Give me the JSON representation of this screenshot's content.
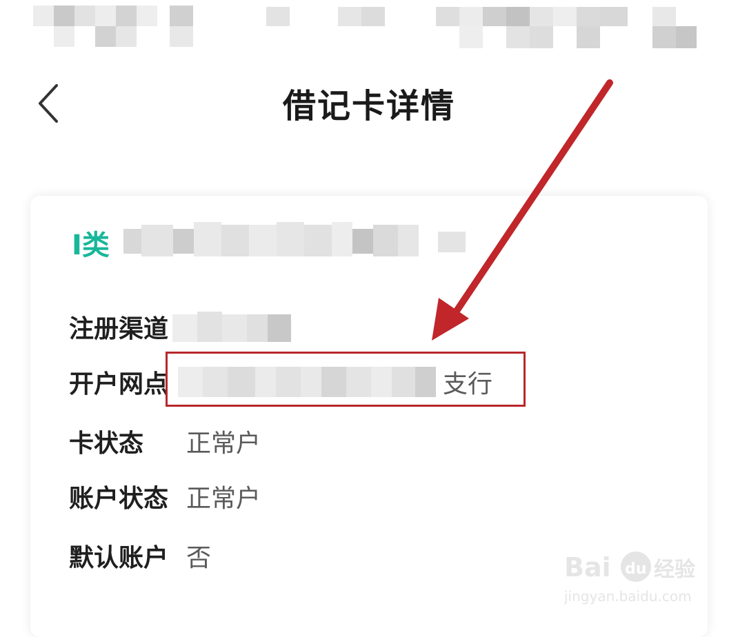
{
  "header": {
    "title": "借记卡详情",
    "back_icon": "chevron-left-icon"
  },
  "card": {
    "type_label": "I类",
    "rows": [
      {
        "label": "注册渠道",
        "value": ""
      },
      {
        "label": "开户网点",
        "value": "支行"
      },
      {
        "label": "卡状态",
        "value": "正常户"
      },
      {
        "label": "账户状态",
        "value": "正常户"
      },
      {
        "label": "默认账户",
        "value": "否"
      }
    ]
  },
  "colors": {
    "accent": "#17b79a",
    "annotation": "#b8262b"
  },
  "watermark": {
    "logo": "Bai du 经验",
    "url": "jingyan.baidu.com"
  }
}
